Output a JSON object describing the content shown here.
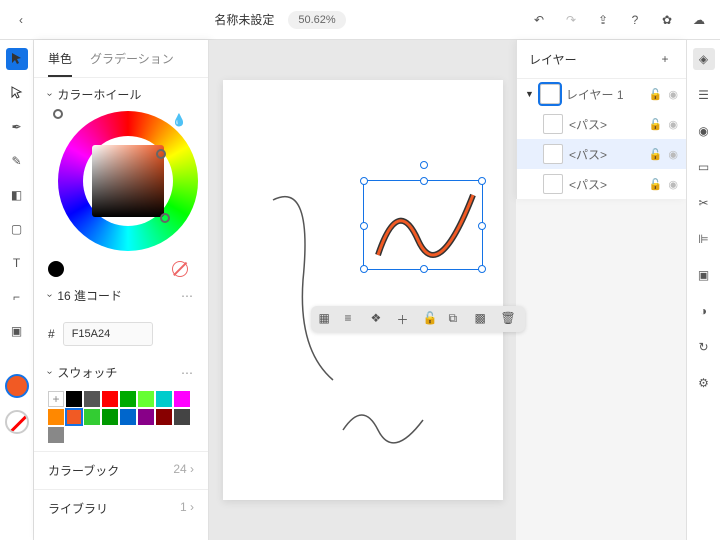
{
  "header": {
    "back": "‹",
    "title": "名称未設定",
    "zoom": "50.62%"
  },
  "color_panel": {
    "tabs": {
      "solid": "単色",
      "gradient": "グラデーション"
    },
    "wheel_label": "カラーホイール",
    "hex_label": "16 進コード",
    "hex_value": "F15A24",
    "swatch_label": "スウォッチ",
    "colorbook": {
      "label": "カラーブック",
      "count": "24 ›"
    },
    "library": {
      "label": "ライブラリ",
      "count": "1 ›"
    },
    "swatches": [
      "#000",
      "#555",
      "#f00",
      "#0a0",
      "#6f3",
      "#0cc",
      "#f0f",
      "#f80",
      "#f15a24",
      "#3c3",
      "#090",
      "#06c",
      "#808",
      "#800",
      "#444",
      "#888"
    ]
  },
  "layers": {
    "title": "レイヤー",
    "items": [
      {
        "name": "レイヤー 1",
        "type": "layer"
      },
      {
        "name": "<パス>",
        "type": "path"
      },
      {
        "name": "<パス>",
        "type": "path",
        "selected": true
      },
      {
        "name": "<パス>",
        "type": "path"
      }
    ]
  }
}
